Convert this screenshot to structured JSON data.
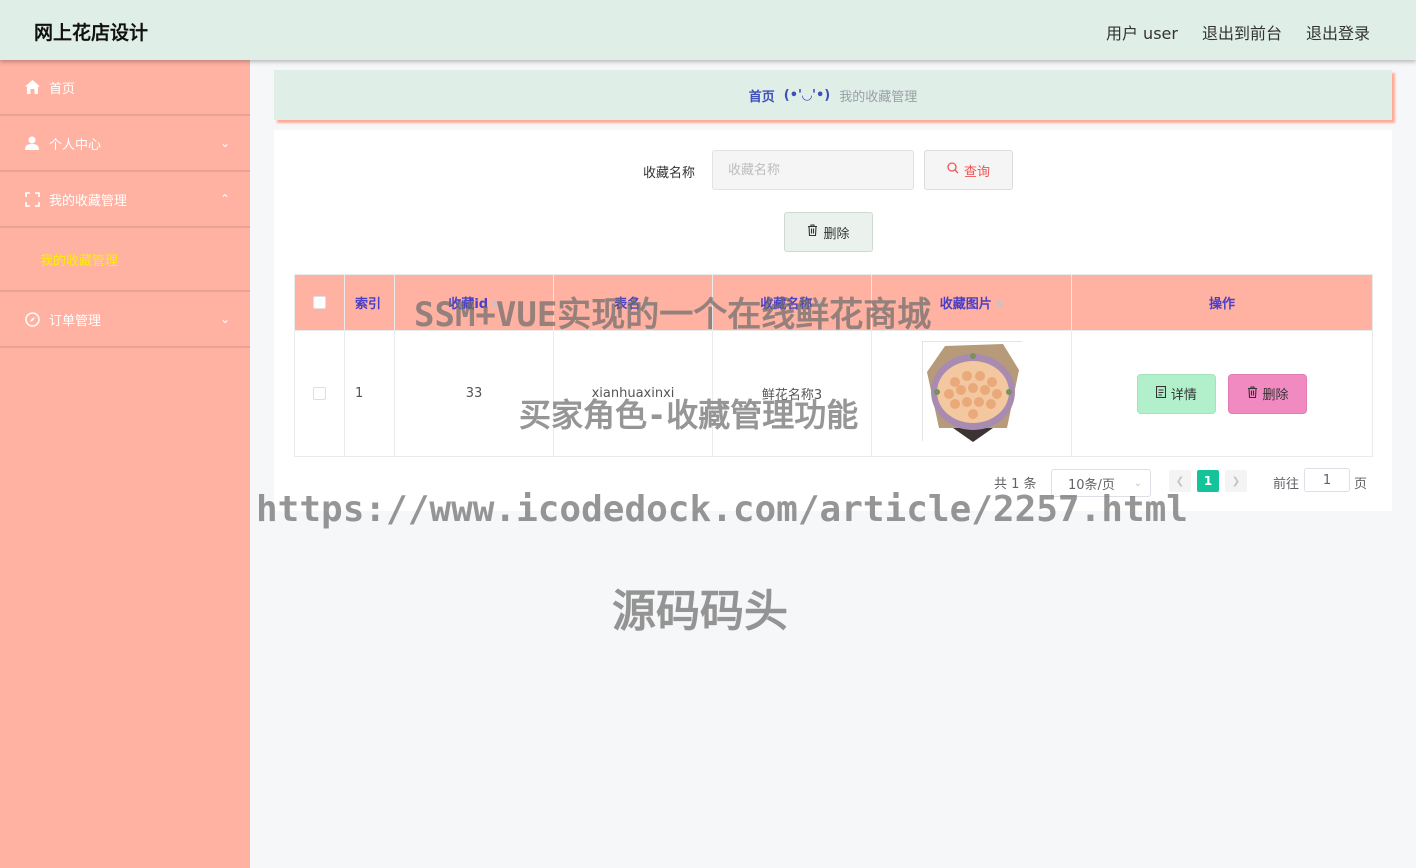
{
  "app": {
    "title": "网上花店设计"
  },
  "header_links": [
    "用户 user",
    "退出到前台",
    "退出登录"
  ],
  "sidebar": {
    "items": [
      {
        "label": "首页",
        "icon": "home-icon"
      },
      {
        "label": "个人中心",
        "icon": "user-icon"
      },
      {
        "label": "我的收藏管理",
        "icon": "favorites-icon"
      },
      {
        "label": "订单管理",
        "icon": "compass-icon"
      }
    ],
    "submenu_active": "我的收藏管理"
  },
  "breadcrumb": {
    "home": "首页",
    "face": "(•'◡'•)",
    "current": "我的收藏管理"
  },
  "search": {
    "label": "收藏名称",
    "placeholder": "收藏名称",
    "query_button": "查询"
  },
  "toolbar": {
    "delete_button": "删除"
  },
  "table": {
    "headers": [
      "索引",
      "收藏id",
      "表名",
      "收藏名称",
      "收藏图片",
      "操作"
    ],
    "rows": [
      {
        "index": "1",
        "fav_id": "33",
        "table_name": "xianhuaxinxi",
        "fav_name": "鲜花名称3",
        "detail": "详情",
        "delete": "删除"
      }
    ]
  },
  "pagination": {
    "total": "共 1 条",
    "page_size": "10条/页",
    "current": "1",
    "goto": "前往",
    "goto_value": "1",
    "page_suffix": "页"
  },
  "watermarks": [
    "SSM+VUE实现的一个在线鲜花商城",
    "买家角色-收藏管理功能",
    "https://www.icodedock.com/article/2257.html",
    "源码码头"
  ],
  "colors": {
    "sidebar": "#ffb1a2",
    "header": "#e0eee8",
    "accent": "#15c39a",
    "detail_button": "#b2f0cb",
    "delete_button": "#f18ac0"
  }
}
